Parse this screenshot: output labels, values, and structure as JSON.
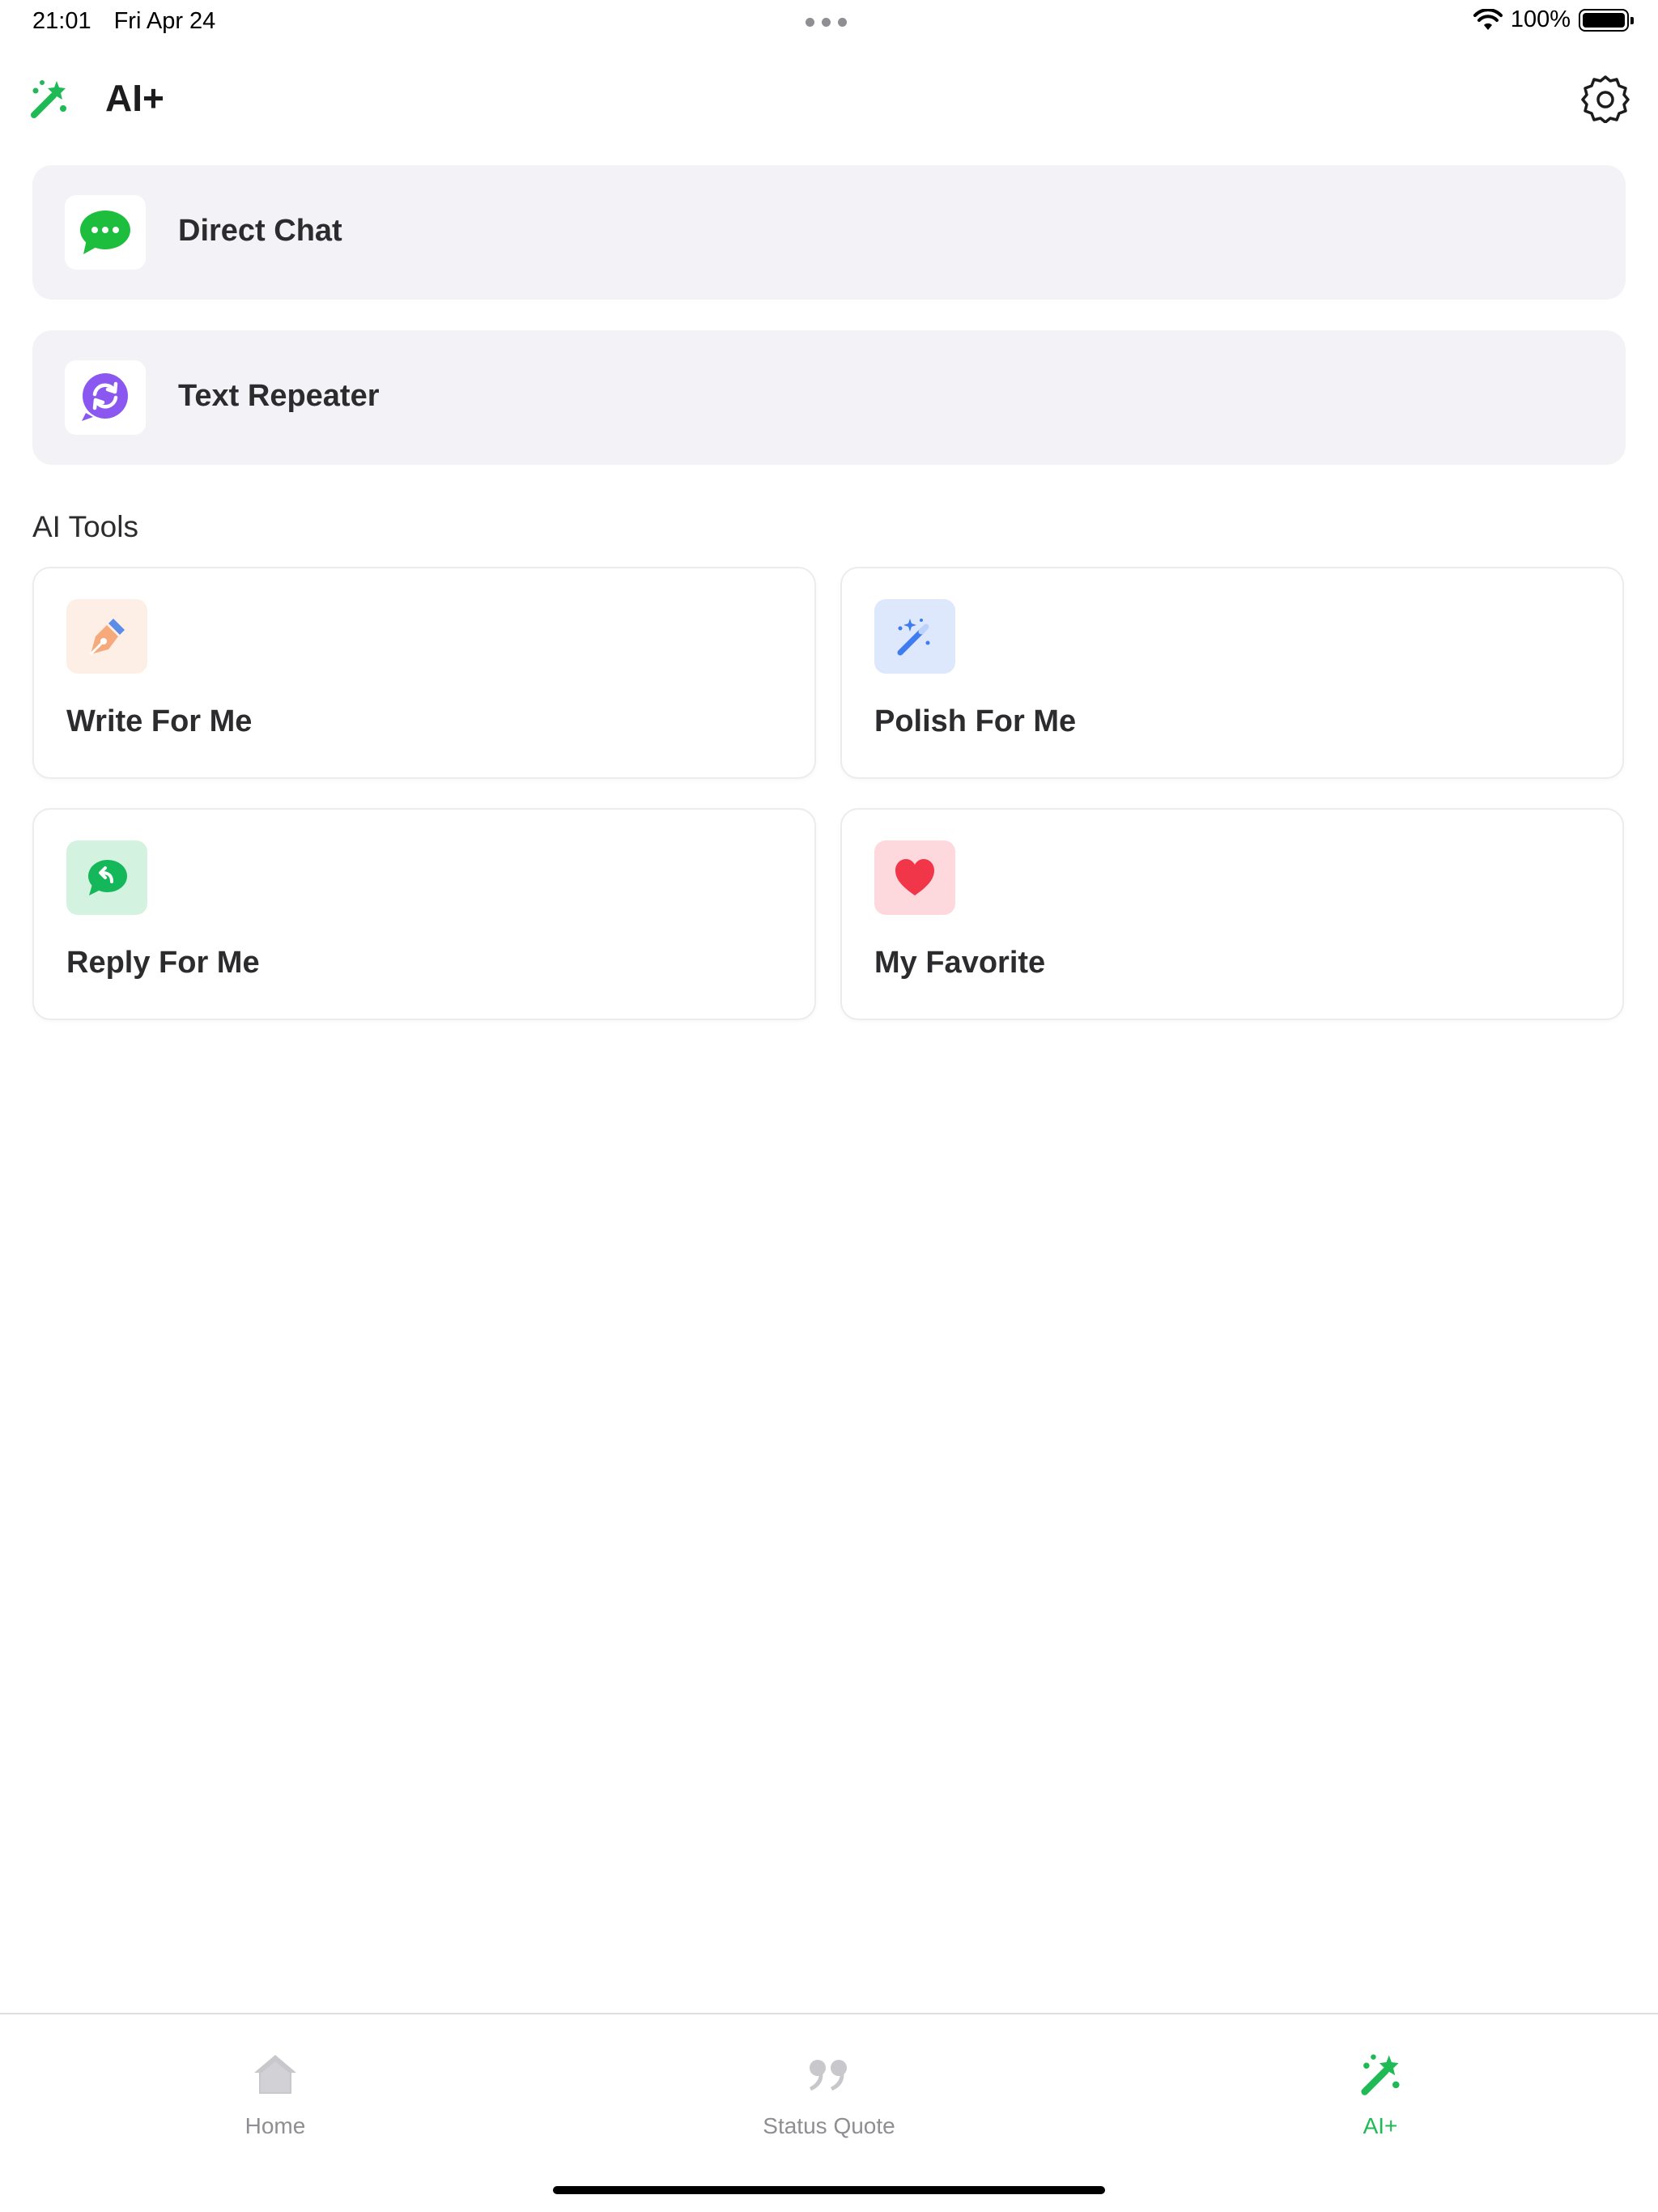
{
  "status_bar": {
    "time": "21:01",
    "date": "Fri Apr 24",
    "battery": "100%"
  },
  "header": {
    "title": "AI+",
    "logo_icon": "magic-wand-icon",
    "settings_icon": "gear-icon"
  },
  "quick_actions": [
    {
      "label": "Direct Chat",
      "icon": "chat-bubble-icon"
    },
    {
      "label": "Text Repeater",
      "icon": "repeat-icon"
    }
  ],
  "tools_section": {
    "title": "AI Tools",
    "items": [
      {
        "label": "Write For Me",
        "icon": "pen-icon",
        "bg": "#fdeee6"
      },
      {
        "label": "Polish For Me",
        "icon": "magic-wand-icon",
        "bg": "#dde8fd"
      },
      {
        "label": "Reply For Me",
        "icon": "reply-icon",
        "bg": "#d3f3e0"
      },
      {
        "label": "My Favorite",
        "icon": "heart-icon",
        "bg": "#fdd9de"
      }
    ]
  },
  "tab_bar": {
    "tabs": [
      {
        "label": "Home",
        "icon": "home-icon",
        "active": false
      },
      {
        "label": "Status Quote",
        "icon": "quote-icon",
        "active": false
      },
      {
        "label": "AI+",
        "icon": "magic-wand-icon",
        "active": true
      }
    ]
  },
  "colors": {
    "accent": "#1fba56",
    "inactive": "#8e8e93",
    "row_background": "#f2f2f7"
  }
}
